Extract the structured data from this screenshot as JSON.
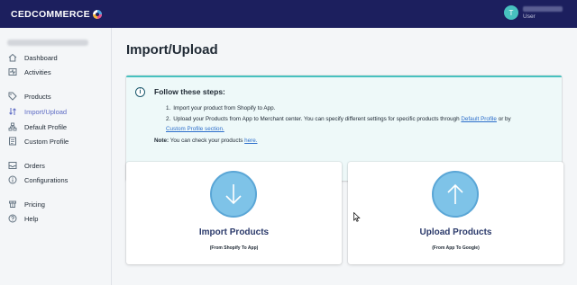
{
  "header": {
    "logo_text": "CEDCOMMERCE",
    "avatar_initial": "T",
    "user_role": "User"
  },
  "sidebar": {
    "items": [
      {
        "label": "Dashboard",
        "icon": "home-icon",
        "active": false
      },
      {
        "label": "Activities",
        "icon": "activity-icon",
        "active": false
      },
      {
        "label": "Products",
        "icon": "tag-icon",
        "active": false
      },
      {
        "label": "Import/Upload",
        "icon": "transfer-icon",
        "active": true
      },
      {
        "label": "Default Profile",
        "icon": "hierarchy-icon",
        "active": false
      },
      {
        "label": "Custom Profile",
        "icon": "profile-doc-icon",
        "active": false
      },
      {
        "label": "Orders",
        "icon": "inbox-icon",
        "active": false
      },
      {
        "label": "Configurations",
        "icon": "info-icon",
        "active": false
      },
      {
        "label": "Pricing",
        "icon": "pricing-icon",
        "active": false
      },
      {
        "label": "Help",
        "icon": "help-icon",
        "active": false
      }
    ]
  },
  "main": {
    "title": "Import/Upload",
    "banner": {
      "title": "Follow these steps:",
      "step1_num": "1.",
      "step1": "Import your product from Shopify to App.",
      "step2_num": "2.",
      "step2_text": "Upload your Products from App to Merchant center. You can specify different settings for specific products through",
      "step2_link1": "Default Profile",
      "step2_or": "or by",
      "step2_link2": "Custom Profile section.",
      "note_label": "Note:",
      "note_text": "You can check your products",
      "note_link": "here."
    },
    "cards": {
      "import": {
        "title": "Import Products",
        "subtitle": "(From Shopify To App)"
      },
      "upload": {
        "title": "Upload Products",
        "subtitle": "(From App To Google)"
      }
    }
  },
  "colors": {
    "topbar": "#1c1f5e",
    "accent_teal": "#47c1bf",
    "active_nav": "#5c6ac4",
    "link": "#2c6ecb",
    "circle_fill": "#7ec3e8"
  }
}
